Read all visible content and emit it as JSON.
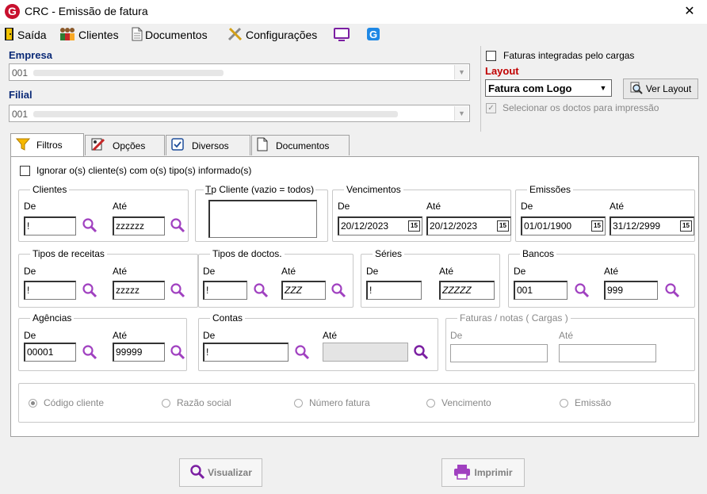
{
  "window": {
    "title": "CRC - Emissão de fatura",
    "close": "✕"
  },
  "toolbar": {
    "saida": "Saída",
    "clientes": "Clientes",
    "documentos": "Documentos",
    "configuracoes": "Configurações"
  },
  "empresa": {
    "label": "Empresa",
    "value": "001"
  },
  "filial": {
    "label": "Filial",
    "value": "001"
  },
  "right_panel": {
    "faturas_integradas": "Faturas integradas pelo cargas",
    "layout_label": "Layout",
    "layout_value": "Fatura com Logo",
    "ver_layout": "Ver Layout",
    "selecionar_doctos": "Selecionar os doctos para impressão"
  },
  "tabs": [
    {
      "label": "Filtros"
    },
    {
      "label": "Opções"
    },
    {
      "label": "Diversos"
    },
    {
      "label": "Documentos"
    }
  ],
  "filters": {
    "ignorar": "Ignorar o(s) cliente(s) com o(s) tipo(s) informado(s)",
    "de": "De",
    "ate": "Até",
    "clientes": {
      "title": "Clientes",
      "de": "!",
      "ate": "zzzzzz"
    },
    "tp_cliente": {
      "title_prefix": "T",
      "title_rest": "p Cliente (vazio = todos)"
    },
    "vencimentos": {
      "title": "Vencimentos",
      "de": "20/12/2023",
      "ate": "20/12/2023"
    },
    "emissoes": {
      "title": "Emissões",
      "de": "01/01/1900",
      "ate": "31/12/2999"
    },
    "tipos_receitas": {
      "title": "Tipos de receitas",
      "de": "!",
      "ate": "zzzzz"
    },
    "tipos_doctos": {
      "title": "Tipos de doctos.",
      "de": "!",
      "ate": "ZZZ"
    },
    "series": {
      "title": "Séries",
      "de": "!",
      "ate": "ZZZZZ"
    },
    "bancos": {
      "title": "Bancos",
      "de": "001",
      "ate": "999"
    },
    "agencias": {
      "title": "Agências",
      "de": "00001",
      "ate": "99999"
    },
    "contas": {
      "title": "Contas",
      "de": "!",
      "ate": ""
    },
    "faturas_notas": {
      "title": "Faturas / notas ( Cargas )",
      "de": "",
      "ate": ""
    },
    "cal_icon": "15"
  },
  "ordering": [
    "Código cliente",
    "Razão social",
    "Número fatura",
    "Vencimento",
    "Emissão"
  ],
  "buttons": {
    "visualizar": "Visualizar",
    "imprimir": "Imprimir"
  },
  "colors": {
    "accent_red": "#c00000",
    "label_blue": "#0b2a77",
    "lens_purple": "#a040c0"
  }
}
